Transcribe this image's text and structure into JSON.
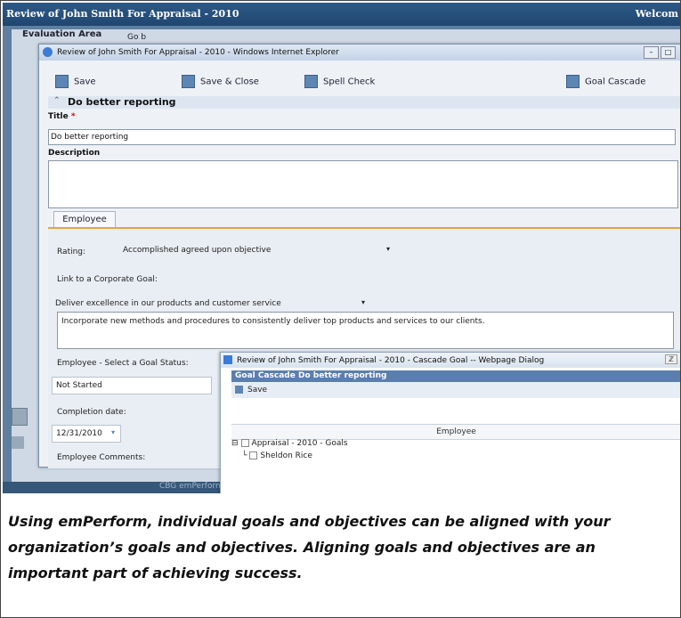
{
  "app": {
    "title": "Review of John Smith For Appraisal - 2010",
    "welcome": "Welcom",
    "back_tab": "Evaluation Area",
    "back_tab2": "Go b",
    "footer": "CBG emPerform v3.12 C"
  },
  "browser_window": {
    "title": "Review of John Smith For Appraisal - 2010 - Windows Internet Explorer",
    "controls": [
      "minimize-icon",
      "maximize-icon"
    ]
  },
  "toolbar": {
    "save": "Save",
    "save_close": "Save & Close",
    "spell_check": "Spell Check",
    "goal_cascade": "Goal Cascade"
  },
  "goal": {
    "section_title": "Do better reporting",
    "title_label": "Title",
    "required_mark": "*",
    "title_value": "Do better reporting",
    "description_label": "Description",
    "description_value": ""
  },
  "employee_tab": {
    "label": "Employee",
    "rating_label": "Rating:",
    "rating_value": "Accomplished agreed upon objective",
    "corporate_goal_label": "Link to a Corporate Goal:",
    "corporate_goal_value": "Deliver excellence in our products and customer service",
    "corporate_goal_text": "Incorporate new methods and procedures to consistently deliver top products and services to our clients.",
    "goal_status_label": "Employee - Select a Goal Status:",
    "goal_status_value": "Not Started",
    "completion_label": "Completion date:",
    "completion_value": "12/31/2010",
    "comments_label": "Employee Comments:"
  },
  "dialog": {
    "title": "Review of John Smith For Appraisal - 2010 - Cascade Goal -- Webpage Dialog",
    "close": "ℤ",
    "header": "Goal Cascade Do better reporting",
    "save": "Save",
    "column_header": "Employee",
    "tree": {
      "root": "Appraisal - 2010 - Goals",
      "child": "Sheldon Rice"
    }
  },
  "caption": "Using emPerform, individual goals and objectives can be aligned with your organization’s goals and objectives. Aligning goals and objectives are an important part of achieving success."
}
